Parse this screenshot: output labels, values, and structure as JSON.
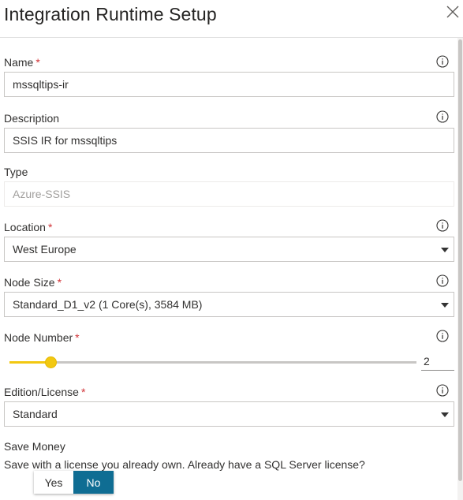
{
  "header": {
    "title": "Integration Runtime Setup",
    "close_icon": "close-icon"
  },
  "fields": {
    "name": {
      "label": "Name",
      "required": "*",
      "value": "mssqltips-ir"
    },
    "description": {
      "label": "Description",
      "value": "SSIS IR for mssqltips"
    },
    "type": {
      "label": "Type",
      "value": "Azure-SSIS"
    },
    "location": {
      "label": "Location",
      "required": "*",
      "value": "West Europe"
    },
    "node_size": {
      "label": "Node Size",
      "required": "*",
      "value": "Standard_D1_v2 (1 Core(s), 3584 MB)"
    },
    "node_number": {
      "label": "Node Number",
      "required": "*",
      "value": "2",
      "slider_fraction": 0.1
    },
    "edition": {
      "label": "Edition/License",
      "required": "*",
      "value": "Standard"
    }
  },
  "save_money": {
    "label": "Save Money",
    "question": "Save with a license you already own. Already have a SQL Server license?",
    "options": [
      "Yes",
      "No"
    ],
    "selected": "No"
  },
  "colors": {
    "required": "#d13438",
    "slider": "#f2c811",
    "toggle_on": "#0f6d93"
  }
}
